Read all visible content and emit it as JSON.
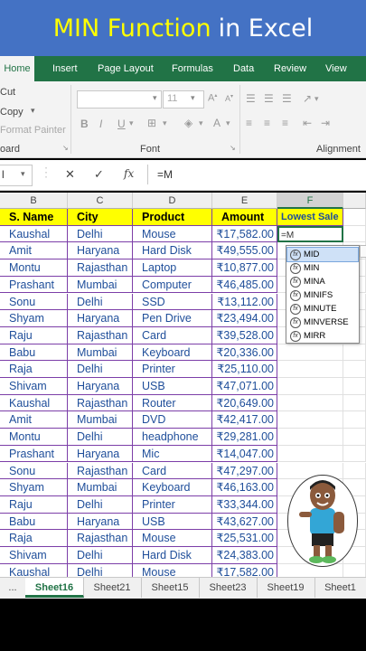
{
  "banner": {
    "part1": "MIN Function",
    "part2": "in Excel"
  },
  "ribbon_tabs": [
    "Home",
    "Insert",
    "Page Layout",
    "Formulas",
    "Data",
    "Review",
    "View"
  ],
  "ribbon": {
    "cut": "Cut",
    "copy": "Copy",
    "format_painter": "Format Painter",
    "clipboard": "oard",
    "font_group": "Font",
    "alignment_group": "Alignment",
    "font_size": "11",
    "bold": "B",
    "italic": "I",
    "underline": "U"
  },
  "formula_bar": {
    "name_box": "l",
    "cancel": "✕",
    "enter": "✓",
    "fx": "fx",
    "formula": "=M"
  },
  "columns": [
    "B",
    "C",
    "D",
    "E",
    "F"
  ],
  "headers": {
    "name": "S. Name",
    "city": "City",
    "product": "Product",
    "amount": "Amount",
    "lowest": "Lowest Sale"
  },
  "active_cell_text": "=M",
  "rows": [
    {
      "name": "Kaushal",
      "city": "Delhi",
      "product": "Mouse",
      "amount": "₹17,582.00"
    },
    {
      "name": "Amit",
      "city": "Haryana",
      "product": "Hard Disk",
      "amount": "₹49,555.00"
    },
    {
      "name": "Montu",
      "city": "Rajasthan",
      "product": "Laptop",
      "amount": "₹10,877.00"
    },
    {
      "name": "Prashant",
      "city": "Mumbai",
      "product": "Computer",
      "amount": "₹46,485.00"
    },
    {
      "name": "Sonu",
      "city": "Delhi",
      "product": "SSD",
      "amount": "₹13,112.00"
    },
    {
      "name": "Shyam",
      "city": "Haryana",
      "product": "Pen Drive",
      "amount": "₹23,494.00"
    },
    {
      "name": "Raju",
      "city": "Rajasthan",
      "product": "Card",
      "amount": "₹39,528.00"
    },
    {
      "name": "Babu",
      "city": "Mumbai",
      "product": "Keyboard",
      "amount": "₹20,336.00"
    },
    {
      "name": "Raja",
      "city": "Delhi",
      "product": "Printer",
      "amount": "₹25,110.00"
    },
    {
      "name": "Shivam",
      "city": "Haryana",
      "product": "USB",
      "amount": "₹47,071.00"
    },
    {
      "name": "Kaushal",
      "city": "Rajasthan",
      "product": "Router",
      "amount": "₹20,649.00"
    },
    {
      "name": "Amit",
      "city": "Mumbai",
      "product": "DVD",
      "amount": "₹42,417.00"
    },
    {
      "name": "Montu",
      "city": "Delhi",
      "product": "headphone",
      "amount": "₹29,281.00"
    },
    {
      "name": "Prashant",
      "city": "Haryana",
      "product": "Mic",
      "amount": "₹14,047.00"
    },
    {
      "name": "Sonu",
      "city": "Rajasthan",
      "product": "Card",
      "amount": "₹47,297.00"
    },
    {
      "name": "Shyam",
      "city": "Mumbai",
      "product": "Keyboard",
      "amount": "₹46,163.00"
    },
    {
      "name": "Raju",
      "city": "Delhi",
      "product": "Printer",
      "amount": "₹33,344.00"
    },
    {
      "name": "Babu",
      "city": "Haryana",
      "product": "USB",
      "amount": "₹43,627.00"
    },
    {
      "name": "Raja",
      "city": "Rajasthan",
      "product": "Mouse",
      "amount": "₹25,531.00"
    },
    {
      "name": "Shivam",
      "city": "Delhi",
      "product": "Hard Disk",
      "amount": "₹24,383.00"
    },
    {
      "name": "Kaushal",
      "city": "Delhi",
      "product": "Mouse",
      "amount": "₹17,582.00"
    }
  ],
  "autocomplete": [
    "MID",
    "MIN",
    "MINA",
    "MINIFS",
    "MINUTE",
    "MINVERSE",
    "MIRR"
  ],
  "sheet_tabs": [
    "...",
    "Sheet16",
    "Sheet21",
    "Sheet15",
    "Sheet23",
    "Sheet19",
    "Sheet1"
  ],
  "colors": {
    "excel_green": "#217346",
    "banner_blue": "#4472c4",
    "header_yellow": "#ffff00",
    "data_blue": "#1f4e9a",
    "border_purple": "#7c3ea8"
  }
}
